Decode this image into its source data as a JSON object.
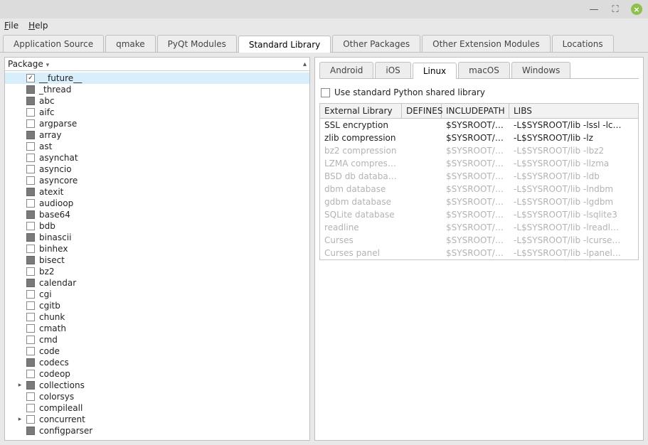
{
  "menubar": {
    "file": "File",
    "help": "Help"
  },
  "main_tabs": [
    {
      "label": "Application Source",
      "active": false
    },
    {
      "label": "qmake",
      "active": false
    },
    {
      "label": "PyQt Modules",
      "active": false
    },
    {
      "label": "Standard Library",
      "active": true
    },
    {
      "label": "Other Packages",
      "active": false
    },
    {
      "label": "Other Extension Modules",
      "active": false
    },
    {
      "label": "Locations",
      "active": false
    }
  ],
  "package_header": "Package",
  "packages": [
    {
      "name": "__future__",
      "state": "checked",
      "selected": true,
      "expandable": false
    },
    {
      "name": "_thread",
      "state": "partial",
      "expandable": false
    },
    {
      "name": "abc",
      "state": "partial",
      "expandable": false
    },
    {
      "name": "aifc",
      "state": "unchecked",
      "expandable": false
    },
    {
      "name": "argparse",
      "state": "unchecked",
      "expandable": false
    },
    {
      "name": "array",
      "state": "partial",
      "expandable": false
    },
    {
      "name": "ast",
      "state": "unchecked",
      "expandable": false
    },
    {
      "name": "asynchat",
      "state": "unchecked",
      "expandable": false
    },
    {
      "name": "asyncio",
      "state": "unchecked",
      "expandable": false
    },
    {
      "name": "asyncore",
      "state": "unchecked",
      "expandable": false
    },
    {
      "name": "atexit",
      "state": "partial",
      "expandable": false
    },
    {
      "name": "audioop",
      "state": "unchecked",
      "expandable": false
    },
    {
      "name": "base64",
      "state": "partial",
      "expandable": false
    },
    {
      "name": "bdb",
      "state": "unchecked",
      "expandable": false
    },
    {
      "name": "binascii",
      "state": "partial",
      "expandable": false
    },
    {
      "name": "binhex",
      "state": "unchecked",
      "expandable": false
    },
    {
      "name": "bisect",
      "state": "partial",
      "expandable": false
    },
    {
      "name": "bz2",
      "state": "unchecked",
      "expandable": false
    },
    {
      "name": "calendar",
      "state": "partial",
      "expandable": false
    },
    {
      "name": "cgi",
      "state": "unchecked",
      "expandable": false
    },
    {
      "name": "cgitb",
      "state": "unchecked",
      "expandable": false
    },
    {
      "name": "chunk",
      "state": "unchecked",
      "expandable": false
    },
    {
      "name": "cmath",
      "state": "unchecked",
      "expandable": false
    },
    {
      "name": "cmd",
      "state": "unchecked",
      "expandable": false
    },
    {
      "name": "code",
      "state": "unchecked",
      "expandable": false
    },
    {
      "name": "codecs",
      "state": "partial",
      "expandable": false
    },
    {
      "name": "codeop",
      "state": "unchecked",
      "expandable": false
    },
    {
      "name": "collections",
      "state": "partial",
      "expandable": true
    },
    {
      "name": "colorsys",
      "state": "unchecked",
      "expandable": false
    },
    {
      "name": "compileall",
      "state": "unchecked",
      "expandable": false
    },
    {
      "name": "concurrent",
      "state": "unchecked",
      "expandable": true
    },
    {
      "name": "configparser",
      "state": "partial",
      "expandable": false
    }
  ],
  "sub_tabs": [
    {
      "label": "Android",
      "active": false
    },
    {
      "label": "iOS",
      "active": false
    },
    {
      "label": "Linux",
      "active": true
    },
    {
      "label": "macOS",
      "active": false
    },
    {
      "label": "Windows",
      "active": false
    }
  ],
  "shared_lib_option": "Use standard Python shared library",
  "table": {
    "headers": {
      "lib": "External Library",
      "defines": "DEFINES",
      "includepath": "INCLUDEPATH",
      "libs": "LIBS"
    },
    "rows": [
      {
        "lib": "SSL encryption",
        "defines": "",
        "inc": "$SYSROOT/i…",
        "libs": "-L$SYSROOT/lib -lssl -lc…",
        "enabled": true
      },
      {
        "lib": "zlib compression",
        "defines": "",
        "inc": "$SYSROOT/i…",
        "libs": "-L$SYSROOT/lib -lz",
        "enabled": true
      },
      {
        "lib": "bz2 compression",
        "defines": "",
        "inc": "$SYSROOT/i…",
        "libs": "-L$SYSROOT/lib -lbz2",
        "enabled": false
      },
      {
        "lib": "LZMA compression",
        "defines": "",
        "inc": "$SYSROOT/i…",
        "libs": "-L$SYSROOT/lib -llzma",
        "enabled": false
      },
      {
        "lib": "BSD db database",
        "defines": "",
        "inc": "$SYSROOT/i…",
        "libs": "-L$SYSROOT/lib -ldb",
        "enabled": false
      },
      {
        "lib": "dbm database",
        "defines": "",
        "inc": "$SYSROOT/i…",
        "libs": "-L$SYSROOT/lib -lndbm",
        "enabled": false
      },
      {
        "lib": "gdbm database",
        "defines": "",
        "inc": "$SYSROOT/i…",
        "libs": "-L$SYSROOT/lib -lgdbm",
        "enabled": false
      },
      {
        "lib": "SQLite database",
        "defines": "",
        "inc": "$SYSROOT/i…",
        "libs": "-L$SYSROOT/lib -lsqlite3",
        "enabled": false
      },
      {
        "lib": "readline",
        "defines": "",
        "inc": "$SYSROOT/i…",
        "libs": "-L$SYSROOT/lib -lreadl…",
        "enabled": false
      },
      {
        "lib": "Curses",
        "defines": "",
        "inc": "$SYSROOT/i…",
        "libs": "-L$SYSROOT/lib -lcurse…",
        "enabled": false
      },
      {
        "lib": "Curses panel",
        "defines": "",
        "inc": "$SYSROOT/i…",
        "libs": "-L$SYSROOT/lib -lpanel…",
        "enabled": false
      }
    ]
  }
}
